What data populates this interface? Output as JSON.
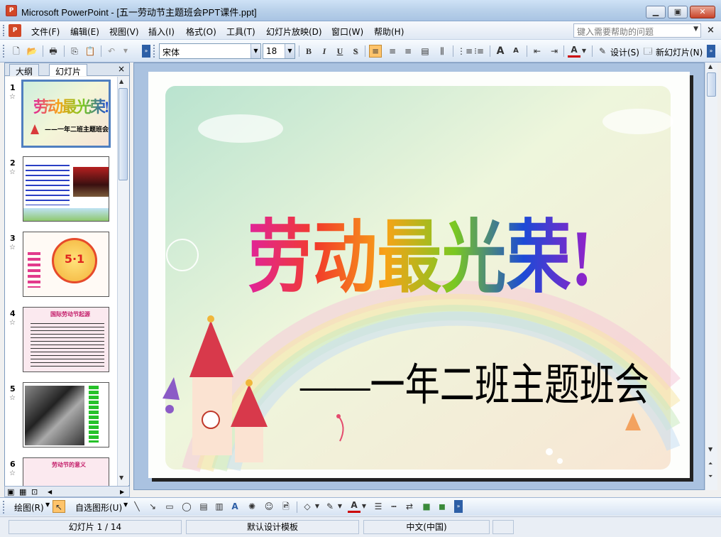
{
  "window": {
    "app_icon": "powerpoint-icon",
    "title": "Microsoft PowerPoint - [五一劳动节主题班会PPT课件.ppt]",
    "minimize_label": "▁",
    "maximize_label": "▣",
    "close_label": "✕"
  },
  "menubar": {
    "items": [
      {
        "label": "文件(F)"
      },
      {
        "label": "编辑(E)"
      },
      {
        "label": "视图(V)"
      },
      {
        "label": "插入(I)"
      },
      {
        "label": "格式(O)"
      },
      {
        "label": "工具(T)"
      },
      {
        "label": "幻灯片放映(D)"
      },
      {
        "label": "窗口(W)"
      },
      {
        "label": "帮助(H)"
      }
    ],
    "help_placeholder": "键入需要帮助的问题",
    "close_doc": "×"
  },
  "toolbar": {
    "font_name": "宋体",
    "font_size": "18",
    "bold": "B",
    "italic": "I",
    "underline": "U",
    "shadow": "S",
    "increase_font": "A",
    "decrease_font": "A",
    "font_color": "A",
    "design_label": "设计(S)",
    "new_slide_label": "新幻灯片(N)"
  },
  "leftpanel": {
    "tab_outline": "大纲",
    "tab_slides": "幻灯片",
    "close": "×",
    "slides": [
      {
        "num": "1",
        "title": "劳动最光荣!",
        "subtitle": "——一年二班主题班会"
      },
      {
        "num": "2"
      },
      {
        "num": "3",
        "badge_text": "5·1"
      },
      {
        "num": "4",
        "heading": "国际劳动节起源"
      },
      {
        "num": "5"
      },
      {
        "num": "6",
        "heading": "劳动节的意义"
      }
    ]
  },
  "slide": {
    "title": "劳动最光荣!",
    "subtitle": "——一年二班主题班会"
  },
  "drawbar": {
    "draw_label": "绘图(R)",
    "autoshape_label": "自选图形(U)"
  },
  "statusbar": {
    "slide_pos": "幻灯片 1 / 14",
    "template": "默认设计模板",
    "language": "中文(中国)"
  },
  "colors": {
    "title_gradient": [
      "#e0249a",
      "#f23c2a",
      "#f7a317",
      "#7ac822",
      "#1c4ad6",
      "#9a20c8"
    ],
    "accent": "#d24726"
  }
}
